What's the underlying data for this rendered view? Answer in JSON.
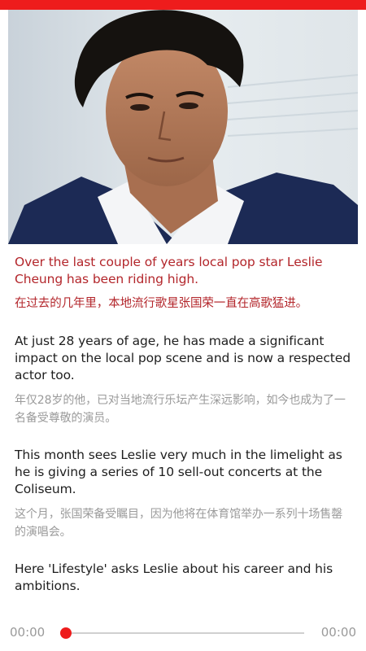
{
  "header": {
    "accent_color": "#ee1c1c"
  },
  "hero": {
    "icon": "portrait-photo"
  },
  "article": {
    "p1_en": "Over the last couple of years local pop star Leslie Cheung has been riding high.",
    "p1_zh": "在过去的几年里，本地流行歌星张国荣一直在高歌猛进。",
    "p2_en": "At just 28 years of age, he has made a significant impact on the local pop scene and is now a respected actor too.",
    "p2_zh": "年仅28岁的他，已对当地流行乐坛产生深远影响，如今也成为了一名备受尊敬的演员。",
    "p3_en": "This month sees Leslie very much in the limelight as he is giving a series of 10 sell-out concerts at the Coliseum.",
    "p3_zh": "这个月，张国荣备受瞩目，因为他将在体育馆举办一系列十场售罄的演唱会。",
    "p4_en": "Here 'Lifestyle' asks Leslie about his career and his ambitions."
  },
  "player": {
    "current_time": "00:00",
    "total_time": "00:00",
    "progress": 0,
    "highlight_color": "#b3262b"
  }
}
